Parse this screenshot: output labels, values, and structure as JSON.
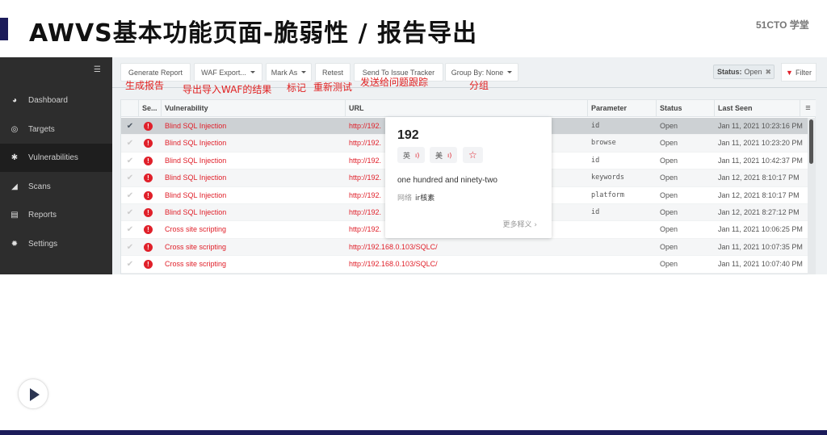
{
  "slide": {
    "title": "AWVS基本功能页面-脆弱性 / 报告导出",
    "brand": "51CTO 学堂"
  },
  "sidebar": {
    "toggle_icon": "menu-collapse-icon",
    "items": [
      {
        "label": "Dashboard",
        "icon": "dashboard-icon",
        "glyph": "◕",
        "active": false
      },
      {
        "label": "Targets",
        "icon": "target-icon",
        "glyph": "◎",
        "active": false
      },
      {
        "label": "Vulnerabilities",
        "icon": "bug-icon",
        "glyph": "✱",
        "active": true
      },
      {
        "label": "Scans",
        "icon": "area-chart-icon",
        "glyph": "◢",
        "active": false
      },
      {
        "label": "Reports",
        "icon": "file-icon",
        "glyph": "▤",
        "active": false
      },
      {
        "label": "Settings",
        "icon": "gear-icon",
        "glyph": "✹",
        "active": false
      }
    ]
  },
  "toolbar": {
    "generate_report": "Generate Report",
    "waf_export": "WAF Export...",
    "mark_as": "Mark As",
    "retest": "Retest",
    "send_to_issue_tracker": "Send To Issue Tracker",
    "group_by": "Group By: None",
    "status_filter_label": "Status:",
    "status_filter_value": "Open",
    "filter": "Filter"
  },
  "annotations": {
    "generate_report": "生成报告",
    "waf_export": "导出导入WAF的结果",
    "mark_as": "标记",
    "retest": "重新测试",
    "send_to_issue_tracker": "发送给问题跟踪",
    "group_by": "分组"
  },
  "table": {
    "columns": [
      "Se...",
      "Vulnerability",
      "URL",
      "Parameter",
      "Status",
      "Last Seen"
    ],
    "rows": [
      {
        "vulnerability": "Blind SQL Injection",
        "url": "http://192.",
        "parameter": "id",
        "status": "Open",
        "last_seen": "Jan 11, 2021 10:23:16 PM",
        "selected": true
      },
      {
        "vulnerability": "Blind SQL Injection",
        "url": "http://192.",
        "parameter": "browse",
        "status": "Open",
        "last_seen": "Jan 11, 2021 10:23:20 PM",
        "selected": false
      },
      {
        "vulnerability": "Blind SQL Injection",
        "url": "http://192.",
        "parameter": "id",
        "status": "Open",
        "last_seen": "Jan 11, 2021 10:42:37 PM",
        "selected": false
      },
      {
        "vulnerability": "Blind SQL Injection",
        "url": "http://192.",
        "parameter": "keywords",
        "status": "Open",
        "last_seen": "Jan 12, 2021 8:10:17 PM",
        "selected": false
      },
      {
        "vulnerability": "Blind SQL Injection",
        "url": "http://192.",
        "parameter": "platform",
        "status": "Open",
        "last_seen": "Jan 12, 2021 8:10:17 PM",
        "selected": false
      },
      {
        "vulnerability": "Blind SQL Injection",
        "url": "http://192.",
        "parameter": "id",
        "status": "Open",
        "last_seen": "Jan 12, 2021 8:27:12 PM",
        "selected": false
      },
      {
        "vulnerability": "Cross site scripting",
        "url": "http://192.",
        "parameter": "",
        "status": "Open",
        "last_seen": "Jan 11, 2021 10:06:25 PM",
        "selected": false
      },
      {
        "vulnerability": "Cross site scripting",
        "url": "http://192.168.0.103/SQLC/",
        "parameter": "",
        "status": "Open",
        "last_seen": "Jan 11, 2021 10:07:35 PM",
        "selected": false
      },
      {
        "vulnerability": "Cross site scripting",
        "url": "http://192.168.0.103/SQLC/",
        "parameter": "",
        "status": "Open",
        "last_seen": "Jan 11, 2021 10:07:40 PM",
        "selected": false
      }
    ]
  },
  "dictionary_popup": {
    "word": "192",
    "uk_label": "英",
    "us_label": "美",
    "definition": "one hundred and ninety-two",
    "web_label": "网络",
    "web_value": "ir核素",
    "more": "更多释义 ›"
  },
  "colors": {
    "accent_red": "#e0202a",
    "sidebar_bg": "#2d2d2d",
    "slide_accent": "#1c1c5a"
  }
}
